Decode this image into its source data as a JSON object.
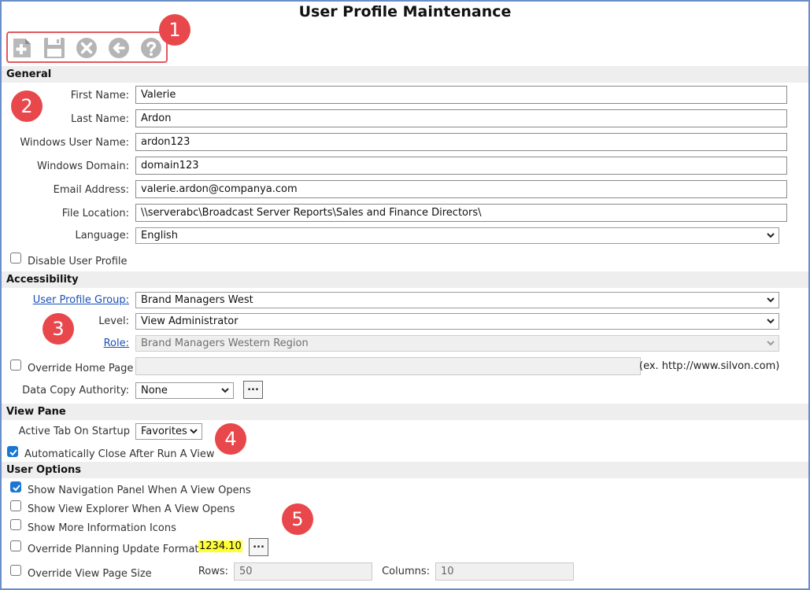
{
  "page": {
    "title": "User Profile Maintenance"
  },
  "toolbar": {
    "icons": [
      "new-document-icon",
      "save-icon",
      "cancel-icon",
      "back-icon",
      "help-icon"
    ]
  },
  "badges": [
    "1",
    "2",
    "3",
    "4",
    "5"
  ],
  "general": {
    "heading": "General",
    "first_name": {
      "label": "First Name:",
      "value": "Valerie"
    },
    "last_name": {
      "label": "Last Name:",
      "value": "Ardon"
    },
    "windows_user_name": {
      "label": "Windows User Name:",
      "value": "ardon123"
    },
    "windows_domain": {
      "label": "Windows Domain:",
      "value": "domain123"
    },
    "email": {
      "label": "Email Address:",
      "value": "valerie.ardon@companya.com"
    },
    "file_location": {
      "label": "File Location:",
      "value": "\\\\serverabc\\Broadcast Server Reports\\Sales and Finance Directors\\"
    },
    "language": {
      "label": "Language:",
      "value": "English"
    },
    "disable_profile": {
      "label": "Disable User Profile",
      "checked": false
    }
  },
  "accessibility": {
    "heading": "Accessibility",
    "group": {
      "label": "User Profile Group:",
      "value": "Brand Managers West"
    },
    "level": {
      "label": "Level:",
      "value": "View Administrator"
    },
    "role": {
      "label": "Role:",
      "value": "Brand Managers Western Region"
    },
    "override_home": {
      "label": "Override Home Page",
      "checked": false,
      "value": "",
      "hint": "(ex. http://www.silvon.com)"
    },
    "data_copy": {
      "label": "Data Copy Authority:",
      "value": "None",
      "button": "..."
    }
  },
  "view_pane": {
    "heading": "View Pane",
    "active_tab": {
      "label": "Active Tab On Startup",
      "value": "Favorites"
    },
    "auto_close": {
      "label": "Automatically Close After Run A View",
      "checked": true
    }
  },
  "user_options": {
    "heading": "User Options",
    "show_nav": {
      "label": "Show Navigation Panel When A View Opens",
      "checked": true
    },
    "show_explorer": {
      "label": "Show View Explorer When A View Opens",
      "checked": false
    },
    "show_info": {
      "label": "Show More Information Icons",
      "checked": false
    },
    "override_planning": {
      "label": "Override Planning Update Format",
      "checked": false,
      "sample": "1234.10",
      "button": "..."
    },
    "override_page_size": {
      "label": "Override View Page Size",
      "checked": false,
      "rows_label": "Rows:",
      "rows": "50",
      "columns_label": "Columns:",
      "columns": "10"
    }
  },
  "colors": {
    "badge": "#e8474c",
    "check": "#1976d2",
    "section_bg": "#eeeeee",
    "frame": "#6a8fc7",
    "highlight": "#ffff33"
  }
}
